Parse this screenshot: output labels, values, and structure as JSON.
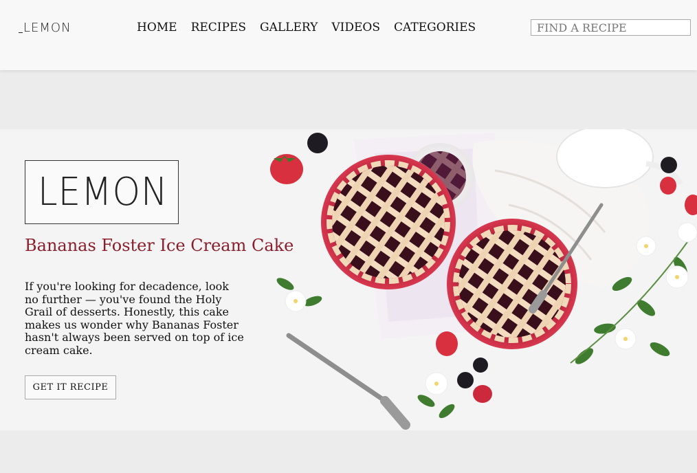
{
  "header": {
    "logo_text": "LEMON",
    "nav": [
      {
        "label": "HOME"
      },
      {
        "label": "RECIPES"
      },
      {
        "label": "GALLERY"
      },
      {
        "label": "VIDEOS"
      },
      {
        "label": "CATEGORIES"
      }
    ],
    "search": {
      "placeholder": "FIND A RECIPE",
      "value": ""
    }
  },
  "hero": {
    "logo_text": "LEMON",
    "title": "Bananas Foster Ice Cream Cake",
    "description": "If you're looking for decadence, look no further — you've found the Holy Grail of desserts. Honestly, this cake makes us wonder why Bananas Foster hasn't always been served on top of ice cream cake.",
    "cta_label": "GET IT RECIPE"
  },
  "colors": {
    "title_accent": "#8b1e2b",
    "topbar_bg": "#f8f8f8",
    "page_bg": "#ececec"
  }
}
